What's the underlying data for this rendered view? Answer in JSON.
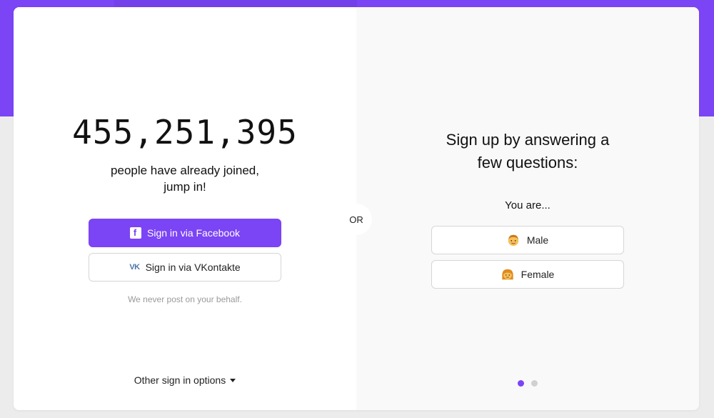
{
  "colors": {
    "brand": "#7b44f5",
    "background": "#ececec",
    "right_panel": "#f9f9f9"
  },
  "left": {
    "counter": "455,251,395",
    "joined_line1": "people have already joined,",
    "joined_line2": "jump in!",
    "facebook_button": {
      "label": "Sign in via Facebook",
      "icon": "facebook-icon"
    },
    "vk_button": {
      "label": "Sign in via VKontakte",
      "icon": "vk-icon"
    },
    "note": "We never post on your behalf.",
    "other_options": "Other sign in options"
  },
  "divider": {
    "label": "OR"
  },
  "right": {
    "title_line1": "Sign up by answering a",
    "title_line2": "few questions:",
    "question": "You are...",
    "options": [
      {
        "label": "Male",
        "icon": "man-emoji-icon"
      },
      {
        "label": "Female",
        "icon": "woman-emoji-icon"
      }
    ],
    "pagination": {
      "current": 1,
      "total": 2
    }
  }
}
